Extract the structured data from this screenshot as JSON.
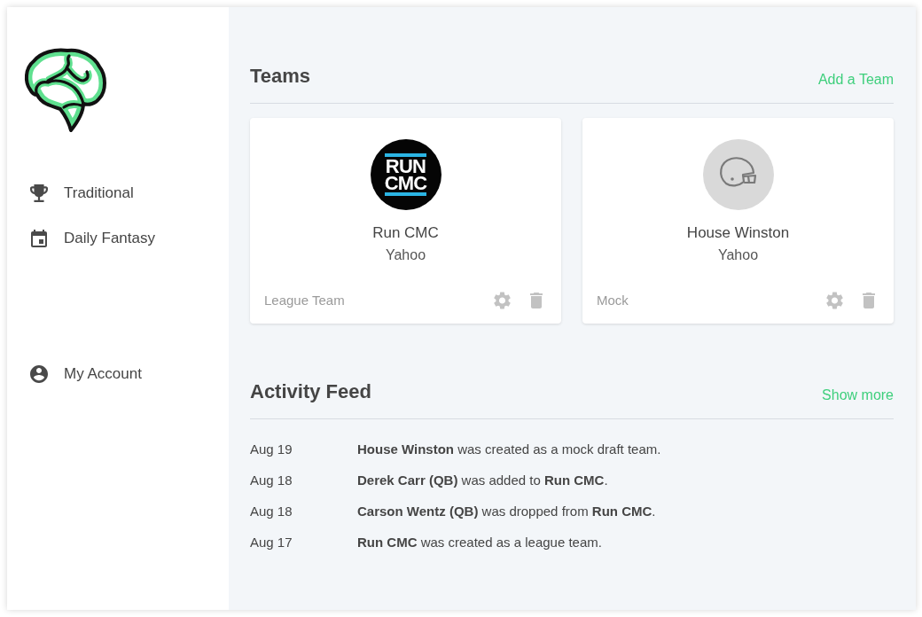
{
  "sidebar": {
    "nav": [
      {
        "label": "Traditional"
      },
      {
        "label": "Daily Fantasy"
      }
    ],
    "account": {
      "label": "My Account"
    }
  },
  "teams": {
    "title": "Teams",
    "action": "Add a Team",
    "cards": [
      {
        "avatar": {
          "kind": "logo",
          "lines": [
            "RUN",
            "CMC"
          ]
        },
        "name": "Run CMC",
        "platform": "Yahoo",
        "type": "League Team"
      },
      {
        "avatar": {
          "kind": "placeholder"
        },
        "name": "House Winston",
        "platform": "Yahoo",
        "type": "Mock"
      }
    ]
  },
  "activity": {
    "title": "Activity Feed",
    "action": "Show more",
    "items": [
      {
        "date": "Aug 19",
        "text": "**House Winston** was created as a mock draft team."
      },
      {
        "date": "Aug 18",
        "text": "**Derek Carr (QB)** was added to **Run CMC**."
      },
      {
        "date": "Aug 18",
        "text": "**Carson Wentz (QB)** was dropped from **Run CMC**."
      },
      {
        "date": "Aug 17",
        "text": "**Run CMC** was created as a league team."
      }
    ]
  }
}
